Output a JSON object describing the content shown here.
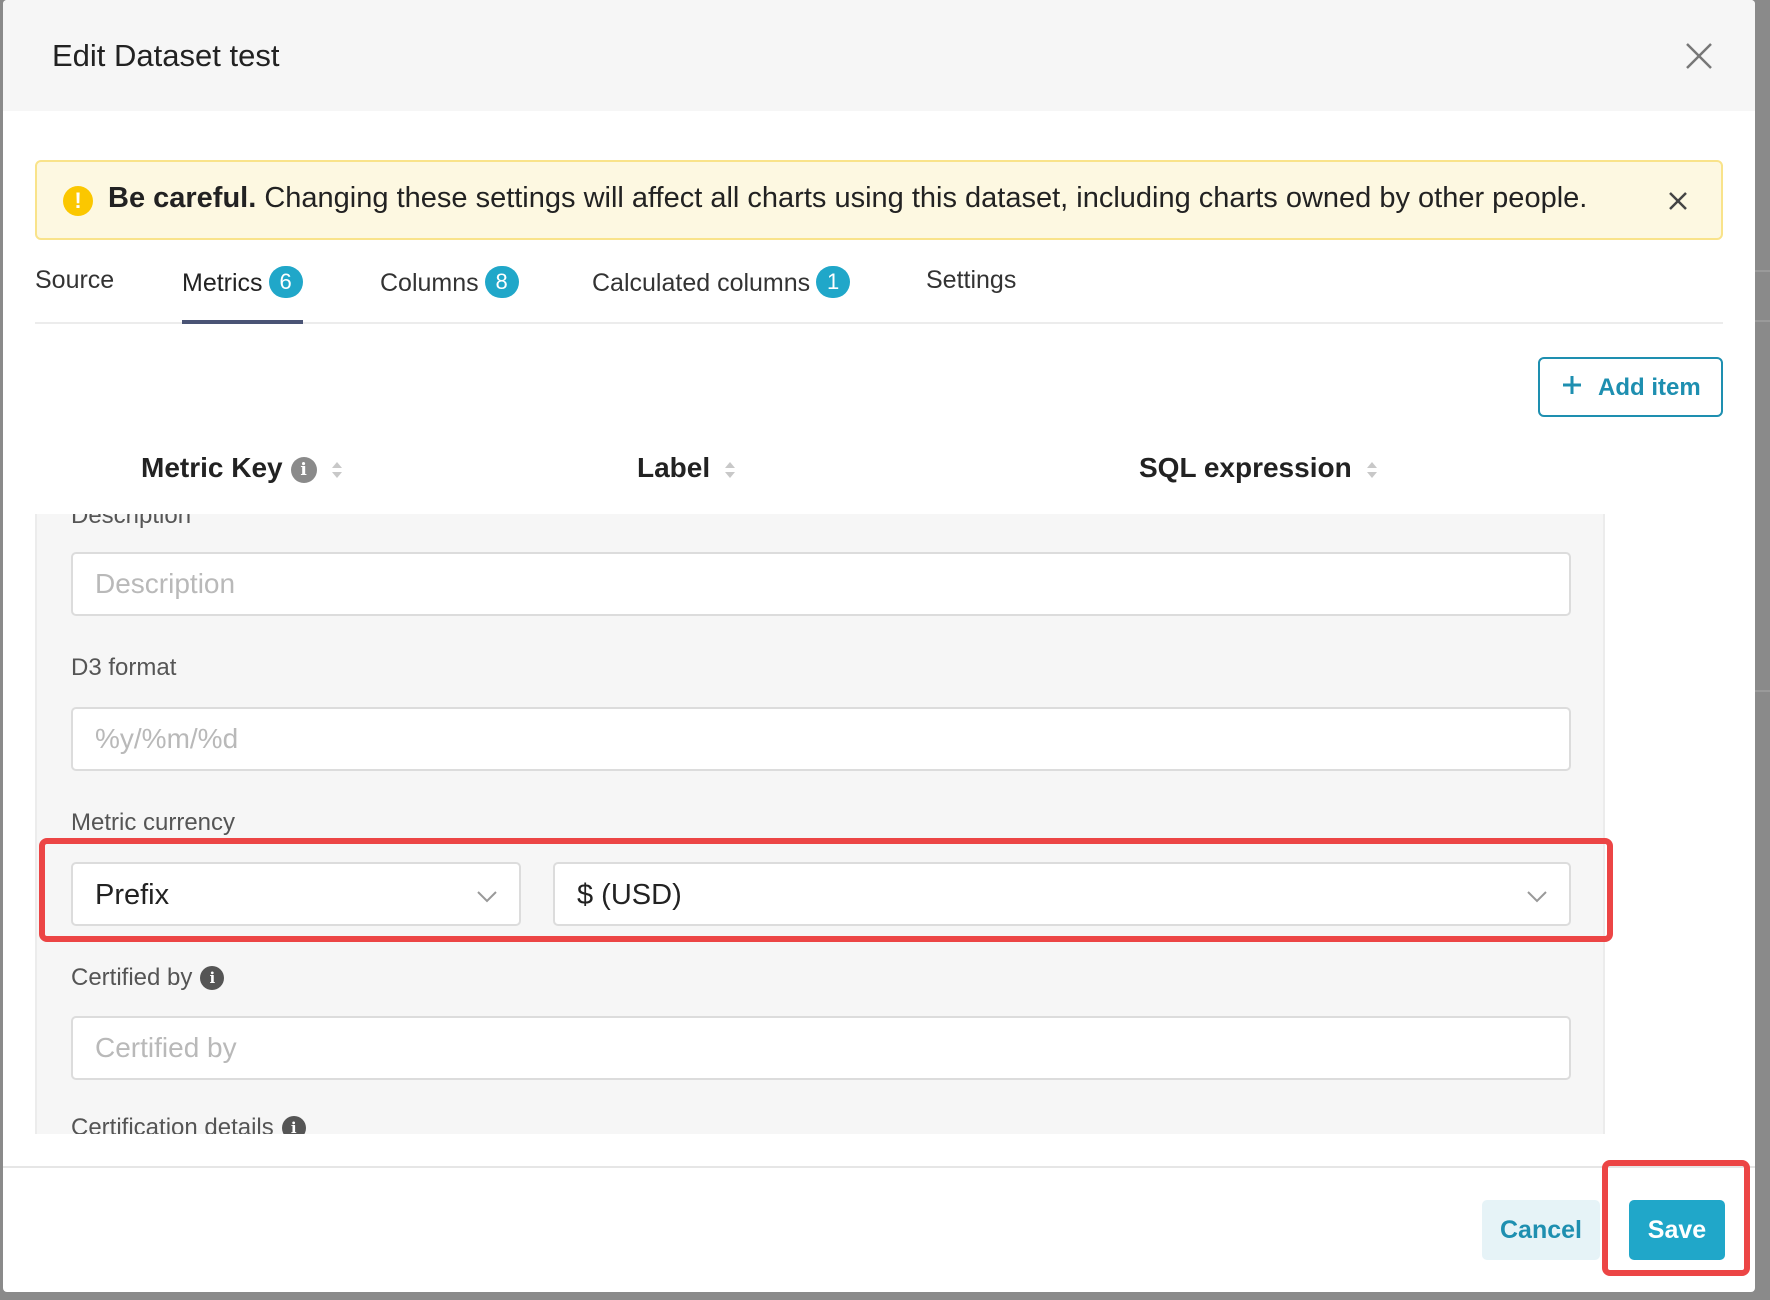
{
  "modal": {
    "title": "Edit Dataset test"
  },
  "alert": {
    "bold": "Be careful.",
    "text": " Changing these settings will affect all charts using this dataset, including charts owned by other people."
  },
  "tabs": [
    {
      "label": "Source"
    },
    {
      "label": "Metrics",
      "count": "6"
    },
    {
      "label": "Columns",
      "count": "8"
    },
    {
      "label": "Calculated columns",
      "count": "1"
    },
    {
      "label": "Settings"
    }
  ],
  "toolbar": {
    "add_item_label": "Add item"
  },
  "table": {
    "headers": [
      "Metric Key",
      "Label",
      "SQL expression"
    ]
  },
  "form": {
    "description": {
      "label": "Description",
      "placeholder": "Description",
      "value": ""
    },
    "d3_format": {
      "label": "D3 format",
      "placeholder": "%y/%m/%d",
      "value": ""
    },
    "metric_currency": {
      "label": "Metric currency",
      "position": "Prefix",
      "currency": "$ (USD)"
    },
    "certified_by": {
      "label": "Certified by",
      "placeholder": "Certified by",
      "value": ""
    },
    "certification_details": {
      "label": "Certification details"
    }
  },
  "footer": {
    "cancel_label": "Cancel",
    "save_label": "Save"
  },
  "colors": {
    "accent": "#20a7c9",
    "highlight": "#ec4545",
    "warning": "#fbc700"
  }
}
